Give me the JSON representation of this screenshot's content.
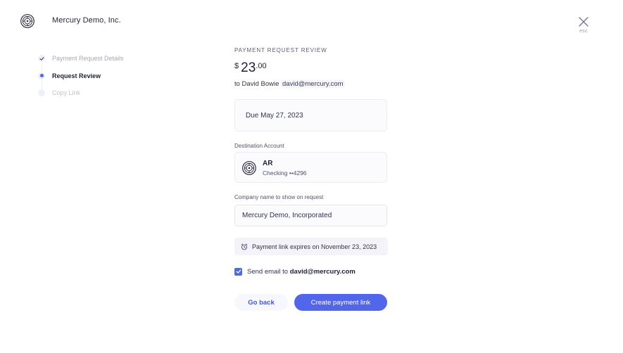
{
  "header": {
    "company_name": "Mercury Demo, Inc.",
    "close_label": "esc"
  },
  "steps": [
    {
      "label": "Payment Request Details",
      "state": "done"
    },
    {
      "label": "Request Review",
      "state": "current"
    },
    {
      "label": "Copy Link",
      "state": "pending"
    }
  ],
  "review": {
    "title": "PAYMENT REQUEST REVIEW",
    "currency_symbol": "$",
    "amount_whole": "23",
    "amount_cents": ".00",
    "recipient_prefix": "to David Bowie",
    "recipient_email": "david@mercury.com",
    "due_text": "Due May 27, 2023",
    "destination_label": "Destination Account",
    "account_name": "AR",
    "account_number": "Checking ••4296",
    "company_field_label": "Company name to show on request",
    "company_field_value": "Mercury Demo, Incorporated",
    "expiry_text": "Payment link expires on November 23, 2023",
    "send_email_prefix": "Send email to",
    "send_email_address": "david@mercury.com",
    "send_email_checked": true
  },
  "actions": {
    "back_label": "Go back",
    "create_label": "Create payment link"
  },
  "colors": {
    "accent": "#5266eb",
    "checkbox": "#4a6ae6",
    "card_bg": "#fbfbfe"
  },
  "icons": {
    "logo": "mercury-logo-icon",
    "close": "close-icon",
    "done_step": "check-icon",
    "expiry": "alarm-clock-icon",
    "checkbox": "checkmark-icon"
  }
}
